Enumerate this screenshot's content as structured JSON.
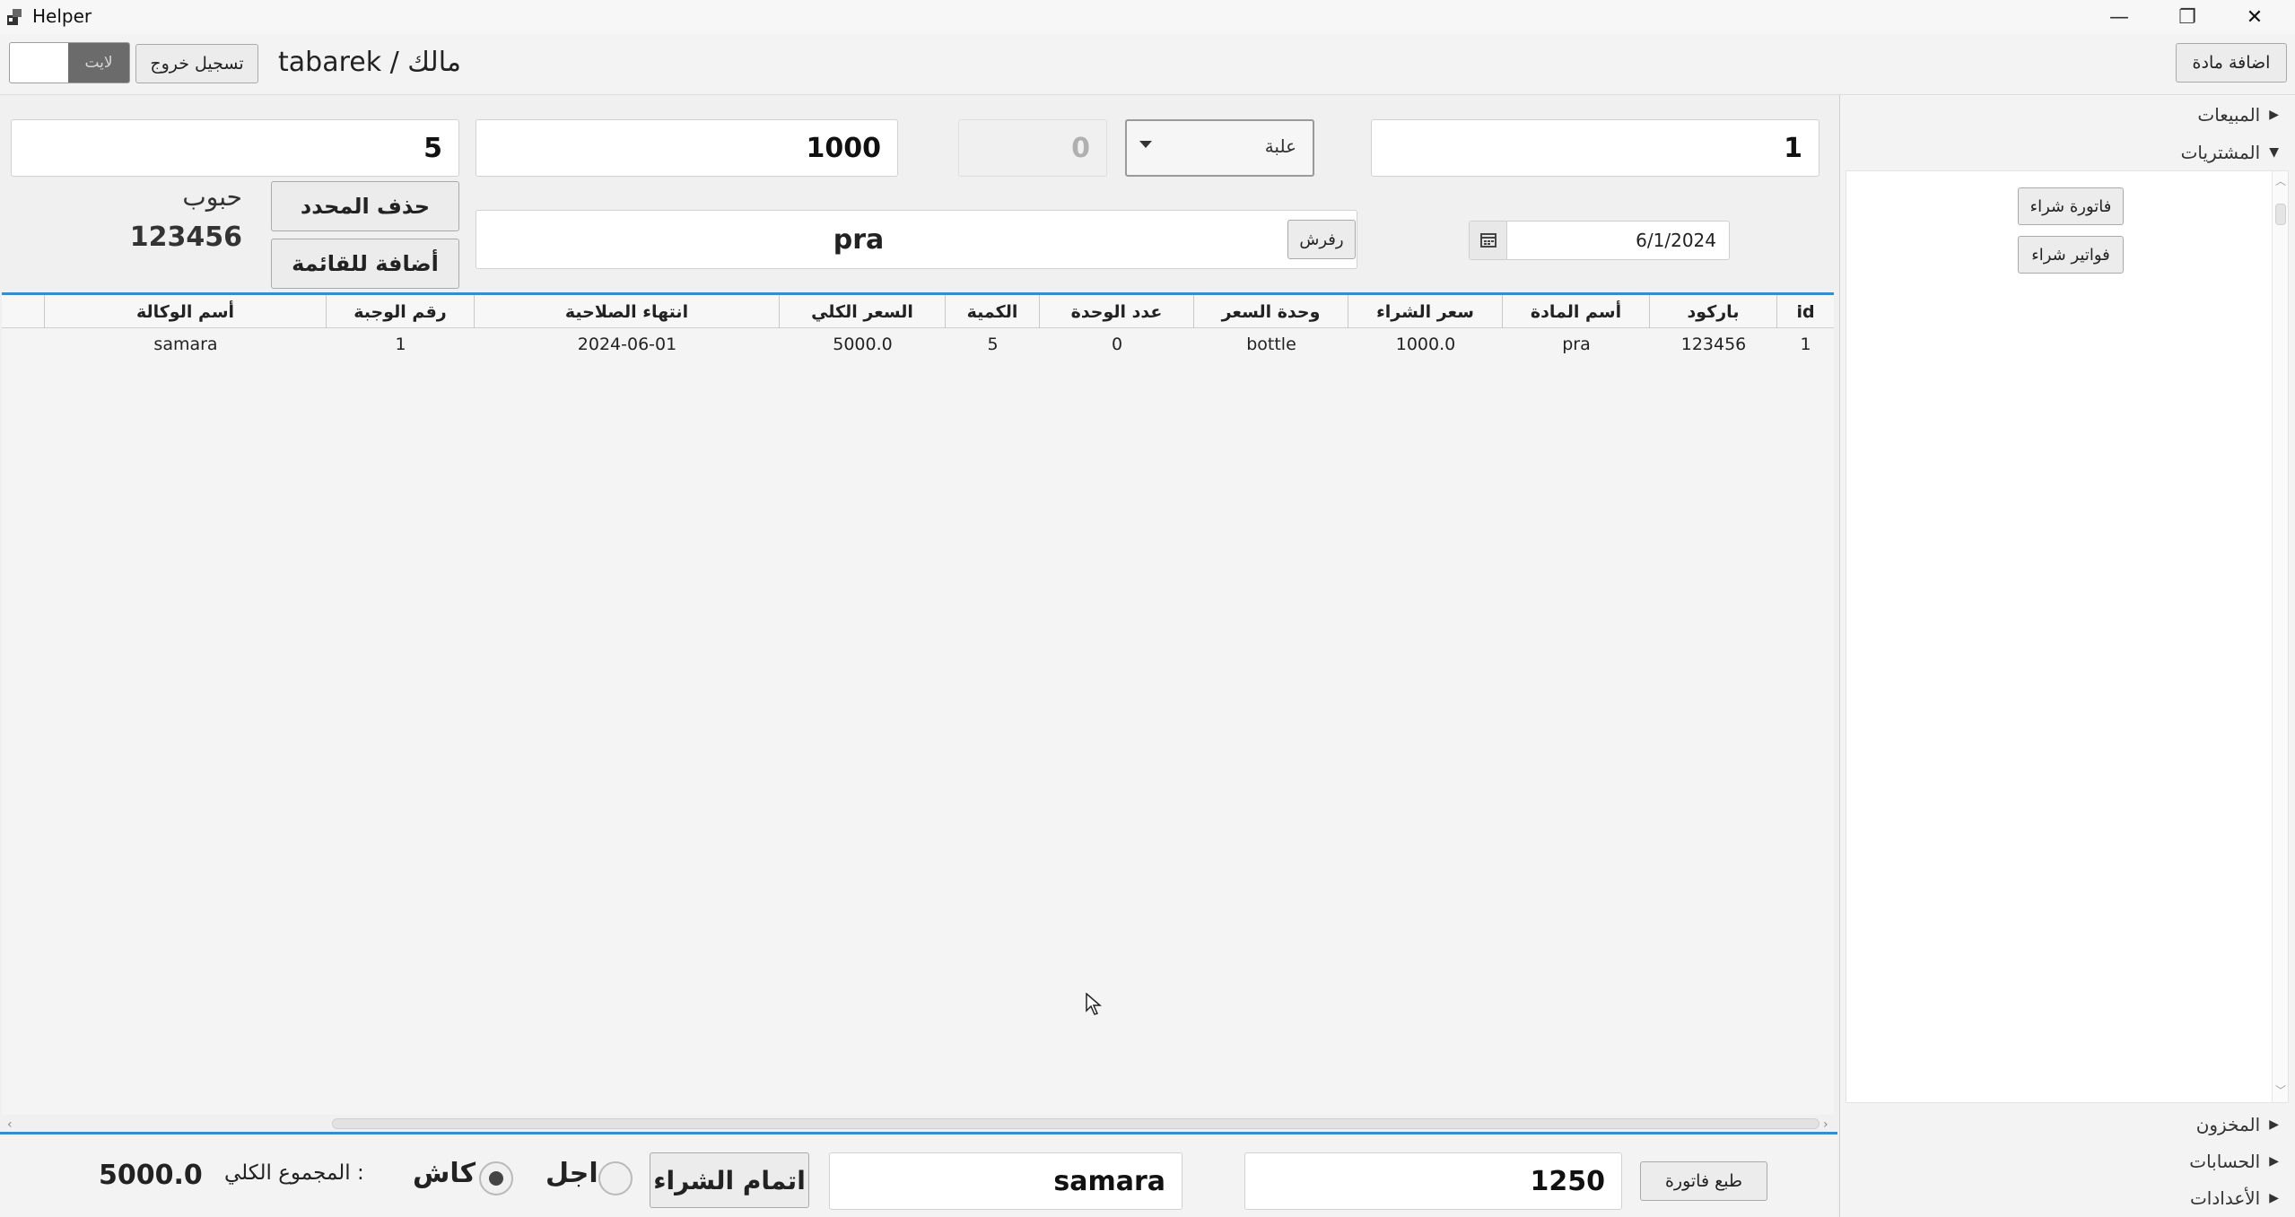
{
  "window": {
    "title": "Helper",
    "minimize_glyph": "—",
    "restore_glyph": "❐",
    "close_glyph": "✕"
  },
  "header": {
    "theme_toggle_label": "لايت",
    "logout_label": "تسجيل خروج",
    "user_label": "tabarek / مالك",
    "add_material_label": "اضافة مادة"
  },
  "form": {
    "row1": {
      "id_value": "1",
      "unit_selected": "علبة",
      "unit_count_value": "0",
      "price_value": "1000",
      "quantity_value": "5"
    },
    "date_value": "6/1/2024",
    "search_value": "pra",
    "refresh_label": "رفرش",
    "delete_selected_label": "حذف المحدد",
    "add_to_list_label": "أضافة للقائمة",
    "category_label": "حبوب",
    "barcode_label": "123456"
  },
  "table": {
    "columns": [
      "id",
      "باركود",
      "أسم المادة",
      "سعر الشراء",
      "وحدة السعر",
      "عدد الوحدة",
      "الكمية",
      "السعر الكلي",
      "انتهاء الصلاحية",
      "رقم الوجبة",
      "أسم الوكالة"
    ],
    "rows": [
      [
        "1",
        "123456",
        "pra",
        "1000.0",
        "bottle",
        "0",
        "5",
        "5000.0",
        "2024-06-01",
        "1",
        "samara"
      ]
    ]
  },
  "sidebar": {
    "sales_label": "المبيعات",
    "purchases_label": "المشتريات",
    "purchase_invoice_label": "فاتورة شراء",
    "purchase_invoices_label": "فواتير شراء",
    "inventory_label": "المخزون",
    "accounts_label": "الحسابات",
    "settings_label": "الأعدادات"
  },
  "footer": {
    "print_invoice_label": "طبع فاتورة",
    "invoice_number_value": "1250",
    "agency_value": "samara",
    "complete_purchase_label": "اتمام الشراء",
    "credit_label": "اجل",
    "cash_label": "كاش",
    "total_label": "المجموع الكلي :",
    "total_value": "5000.0",
    "payment_selected": "cash"
  },
  "colors": {
    "accent": "#3a8cc8",
    "toggle_dark": "#6b6b6b"
  }
}
